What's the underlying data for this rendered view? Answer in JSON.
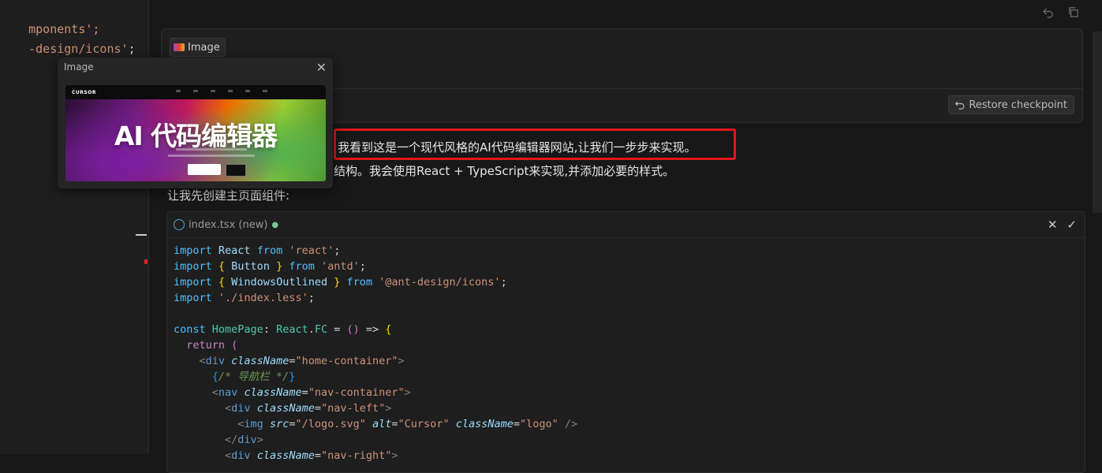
{
  "left_editor": {
    "line1": "mponents';",
    "line2_str": "-design/icons'",
    "line2_end": ";"
  },
  "chat": {
    "attachment_label": "Image",
    "restore_label": "Restore checkpoint",
    "message_line1": "我看到这是一个现代风格的AI代码编辑器网站,让我们一步步来实现。",
    "message_line2": "结构。我会使用React + TypeScript来实现,并添加必要的样式。",
    "message_line3": "让我先创建主页面组件:"
  },
  "code_block": {
    "filename": "index.tsx",
    "status": "(new)",
    "lines": [
      [
        [
          "kw",
          "import "
        ],
        [
          "var",
          "React "
        ],
        [
          "kw",
          "from "
        ],
        [
          "str",
          "'react'"
        ],
        [
          "op",
          ";"
        ]
      ],
      [
        [
          "kw",
          "import "
        ],
        [
          "brace",
          "{ "
        ],
        [
          "var",
          "Button "
        ],
        [
          "brace",
          "} "
        ],
        [
          "kw",
          "from "
        ],
        [
          "str",
          "'antd'"
        ],
        [
          "op",
          ";"
        ]
      ],
      [
        [
          "kw",
          "import "
        ],
        [
          "brace",
          "{ "
        ],
        [
          "var",
          "WindowsOutlined "
        ],
        [
          "brace",
          "} "
        ],
        [
          "kw",
          "from "
        ],
        [
          "str",
          "'@ant-design/icons'"
        ],
        [
          "op",
          ";"
        ]
      ],
      [
        [
          "kw",
          "import "
        ],
        [
          "str",
          "'./index.less'"
        ],
        [
          "op",
          ";"
        ]
      ],
      [
        [
          "op",
          ""
        ]
      ],
      [
        [
          "kw",
          "const "
        ],
        [
          "fn",
          "HomePage"
        ],
        [
          "op",
          ": "
        ],
        [
          "fn",
          "React"
        ],
        [
          "op",
          "."
        ],
        [
          "fn",
          "FC"
        ],
        [
          "op",
          " = "
        ],
        [
          "br2",
          "()"
        ],
        [
          "op",
          " => "
        ],
        [
          "brace",
          "{"
        ]
      ],
      [
        [
          "op",
          "  "
        ],
        [
          "kw2",
          "return "
        ],
        [
          "br2",
          "("
        ]
      ],
      [
        [
          "op",
          "    "
        ],
        [
          "tagp",
          "<"
        ],
        [
          "tag",
          "div "
        ],
        [
          "attr",
          "className"
        ],
        [
          "op",
          "="
        ],
        [
          "str",
          "\"home-container\""
        ],
        [
          "tagp",
          ">"
        ]
      ],
      [
        [
          "op",
          "      "
        ],
        [
          "br3",
          "{"
        ],
        [
          "cmt",
          "/* 导航栏 */"
        ],
        [
          "br3",
          "}"
        ]
      ],
      [
        [
          "op",
          "      "
        ],
        [
          "tagp",
          "<"
        ],
        [
          "tag",
          "nav "
        ],
        [
          "attr",
          "className"
        ],
        [
          "op",
          "="
        ],
        [
          "str",
          "\"nav-container\""
        ],
        [
          "tagp",
          ">"
        ]
      ],
      [
        [
          "op",
          "        "
        ],
        [
          "tagp",
          "<"
        ],
        [
          "tag",
          "div "
        ],
        [
          "attr",
          "className"
        ],
        [
          "op",
          "="
        ],
        [
          "str",
          "\"nav-left\""
        ],
        [
          "tagp",
          ">"
        ]
      ],
      [
        [
          "op",
          "          "
        ],
        [
          "tagp",
          "<"
        ],
        [
          "tag",
          "img "
        ],
        [
          "attr",
          "src"
        ],
        [
          "op",
          "="
        ],
        [
          "str",
          "\"/logo.svg\" "
        ],
        [
          "attr",
          "alt"
        ],
        [
          "op",
          "="
        ],
        [
          "str",
          "\"Cursor\" "
        ],
        [
          "attr",
          "className"
        ],
        [
          "op",
          "="
        ],
        [
          "str",
          "\"logo\" "
        ],
        [
          "tagp",
          "/>"
        ]
      ],
      [
        [
          "op",
          "        "
        ],
        [
          "tagp",
          "</"
        ],
        [
          "tag",
          "div"
        ],
        [
          "tagp",
          ">"
        ]
      ],
      [
        [
          "op",
          "        "
        ],
        [
          "tagp",
          "<"
        ],
        [
          "tag",
          "div "
        ],
        [
          "attr",
          "className"
        ],
        [
          "op",
          "="
        ],
        [
          "str",
          "\"nav-right\""
        ],
        [
          "tagp",
          ">"
        ]
      ]
    ]
  },
  "image_popup": {
    "title": "Image",
    "preview_logo": "CURSOR",
    "preview_heading": "AI 代码编辑器"
  },
  "colors": {
    "highlight_border": "#e3161a",
    "background": "#181818"
  }
}
